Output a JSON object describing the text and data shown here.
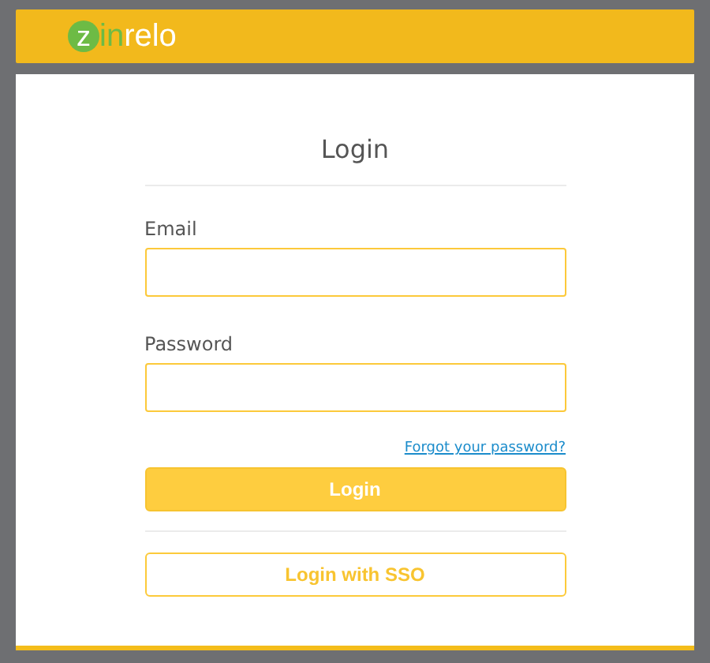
{
  "header": {
    "logo": {
      "mark": "z",
      "accent": "in",
      "rest": "relo"
    }
  },
  "dialog": {
    "title": "Login",
    "fields": [
      {
        "label": "Email"
      },
      {
        "label": "Password"
      }
    ],
    "forgot_link": "Forgot your password?",
    "buttons": [
      {
        "label": "Login",
        "kind": "primary"
      },
      {
        "label": "Login with SSO",
        "kind": "outline"
      }
    ]
  }
}
